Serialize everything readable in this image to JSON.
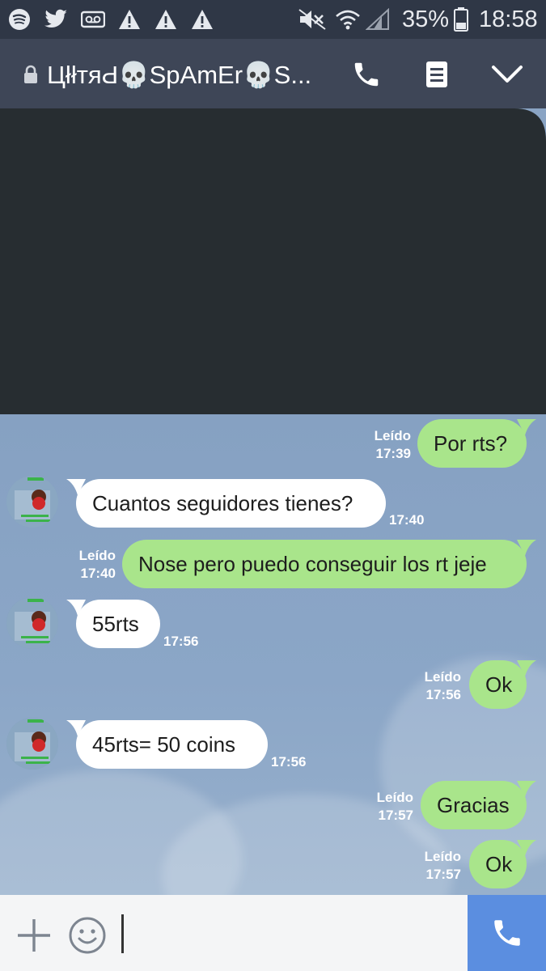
{
  "status_bar": {
    "battery_percent": "35%",
    "time": "18:58",
    "icons": [
      "spotify-icon",
      "twitter-icon",
      "voicemail-icon",
      "warning-icon",
      "warning-icon",
      "warning-icon",
      "mute-icon",
      "wifi-icon",
      "signal-icon",
      "battery-icon"
    ]
  },
  "header": {
    "title": "ЦłłтяԀ💀SpAmEr💀S...",
    "icons": [
      "lock-icon",
      "phone-icon",
      "notes-icon",
      "chevron-down-icon"
    ]
  },
  "messages": [
    {
      "direction": "out",
      "text": "Por rts?",
      "read_label": "Leído",
      "time": "17:39"
    },
    {
      "direction": "in",
      "text": "Cuantos seguidores tienes?",
      "time": "17:40"
    },
    {
      "direction": "out",
      "text": "Nose pero puedo conseguir los rt jeje",
      "read_label": "Leído",
      "time": "17:40"
    },
    {
      "direction": "in",
      "text": "55rts",
      "time": "17:56"
    },
    {
      "direction": "out",
      "text": "Ok",
      "read_label": "Leído",
      "time": "17:56"
    },
    {
      "direction": "in",
      "text": "45rts= 50 coins",
      "time": "17:56"
    },
    {
      "direction": "out",
      "text": "Gracias",
      "read_label": "Leído",
      "time": "17:57"
    },
    {
      "direction": "out",
      "text": "Ok",
      "read_label": "Leído",
      "time": "17:57"
    }
  ],
  "input_bar": {
    "icons": [
      "plus-icon",
      "emoji-icon",
      "phone-icon"
    ]
  },
  "colors": {
    "status_bar_bg": "#2f3746",
    "header_bg": "#3e4657",
    "outgoing_bubble": "#a9e58b",
    "incoming_bubble": "#ffffff",
    "chat_bg": "#8aa4c4",
    "call_button": "#5b8ee0"
  }
}
